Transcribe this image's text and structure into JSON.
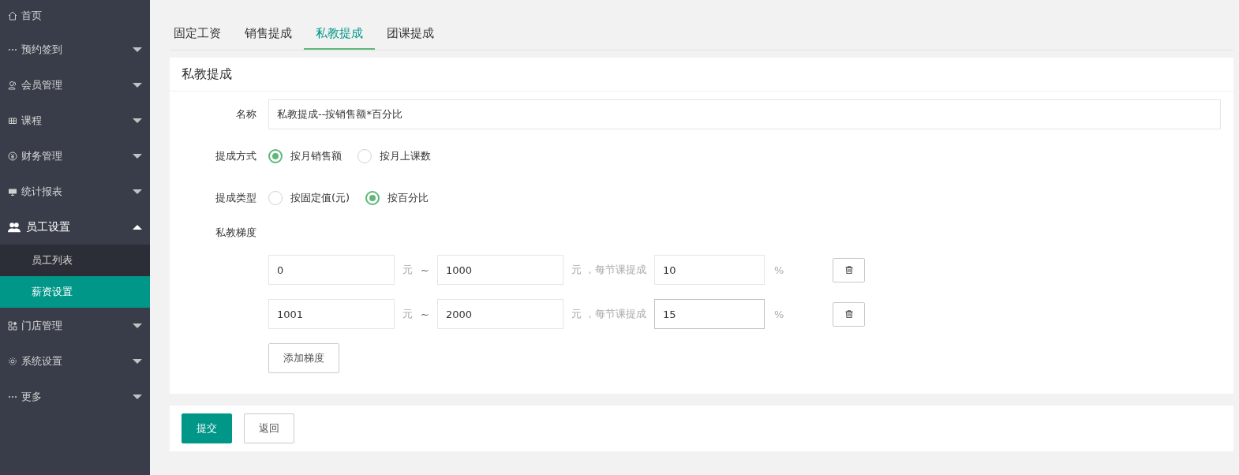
{
  "sidebar": {
    "items": [
      {
        "label": "首页",
        "kind": "link",
        "expanded": false
      },
      {
        "label": "预约签到",
        "kind": "menu",
        "expanded": false
      },
      {
        "label": "会员管理",
        "kind": "menu",
        "expanded": false
      },
      {
        "label": "课程",
        "kind": "menu",
        "expanded": false
      },
      {
        "label": "财务管理",
        "kind": "menu",
        "expanded": false
      },
      {
        "label": "统计报表",
        "kind": "menu",
        "expanded": false
      },
      {
        "label": "员工设置",
        "kind": "menu",
        "expanded": true,
        "children": [
          {
            "label": "员工列表",
            "selected": false
          },
          {
            "label": "薪资设置",
            "selected": true
          }
        ]
      },
      {
        "label": "门店管理",
        "kind": "menu",
        "expanded": false
      },
      {
        "label": "系统设置",
        "kind": "menu",
        "expanded": false
      },
      {
        "label": "更多",
        "kind": "menu",
        "expanded": false
      }
    ]
  },
  "tabs": [
    {
      "label": "固定工资",
      "selected": false
    },
    {
      "label": "销售提成",
      "selected": false
    },
    {
      "label": "私教提成",
      "selected": true
    },
    {
      "label": "团课提成",
      "selected": false
    }
  ],
  "card": {
    "title": "私教提成",
    "name_field": {
      "label": "名称",
      "value": "私教提成--按销售额*百分比"
    },
    "radio_groups": [
      {
        "label": "提成方式",
        "options": [
          {
            "label": "按月销售额",
            "selected": true
          },
          {
            "label": "按月上课数",
            "selected": false
          }
        ]
      },
      {
        "label": "提成类型",
        "options": [
          {
            "label": "按固定值(元)",
            "selected": false
          },
          {
            "label": "按百分比",
            "selected": true
          }
        ]
      }
    ],
    "tiers": {
      "label": "私教梯度",
      "rows": [
        {
          "from": "0",
          "unit_1": "元",
          "separator": "~",
          "to": "1000",
          "unit_2": "元",
          "rate_label": "，每节课提成",
          "rate": "10",
          "unit_3": "%",
          "rate_focused": false
        },
        {
          "from": "1001",
          "unit_1": "元",
          "separator": "~",
          "to": "2000",
          "unit_2": "元",
          "rate_label": "，每节课提成",
          "rate": "15",
          "unit_3": "%",
          "rate_focused": true
        }
      ],
      "add_button": "添加梯度"
    }
  },
  "actions": {
    "submit": "提交",
    "back": "返回"
  }
}
